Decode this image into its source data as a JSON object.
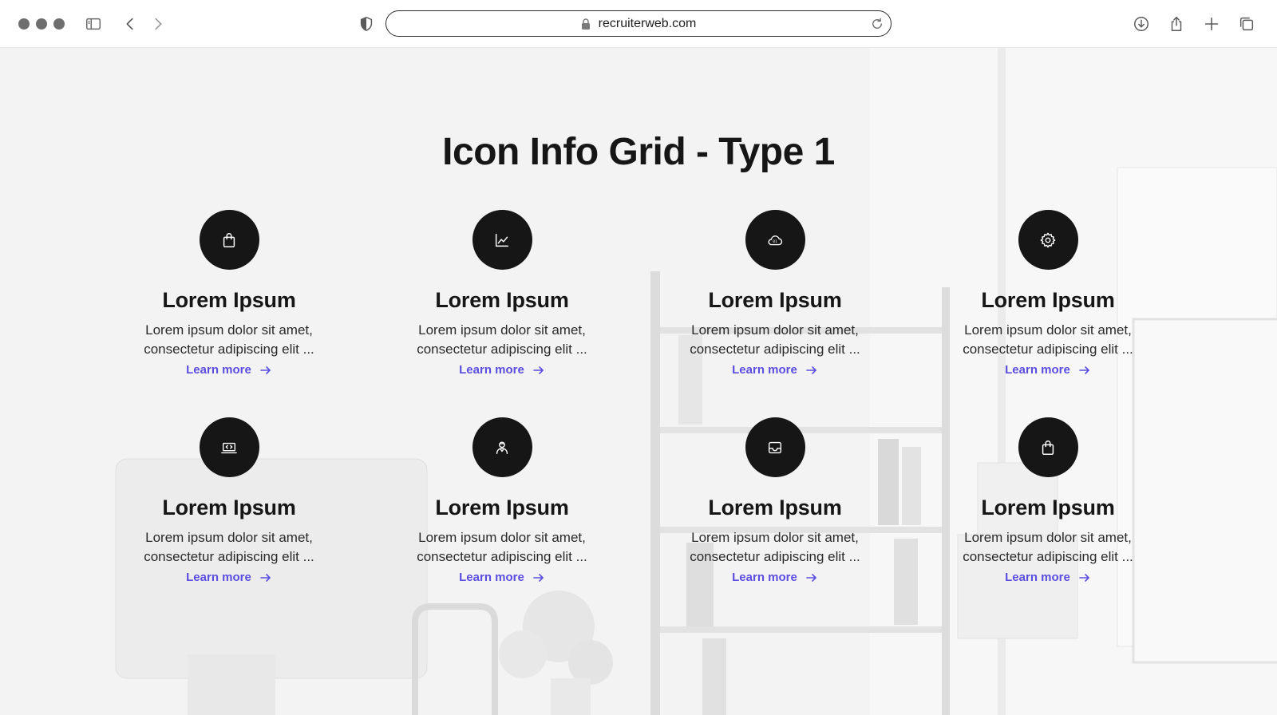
{
  "browser": {
    "url": "recruiterweb.com",
    "icons": [
      "sidebar-icon",
      "back-icon",
      "forward-icon",
      "shield-icon",
      "lock-icon",
      "reload-icon",
      "download-icon",
      "share-icon",
      "new-tab-icon",
      "tabs-overview-icon"
    ]
  },
  "page": {
    "heading": "Icon Info Grid - Type 1",
    "accent_color": "#5b4de0",
    "icon_circle_color": "#161616"
  },
  "cards": [
    {
      "icon": "shopping-bag-icon",
      "title": "Lorem Ipsum",
      "line1": "Lorem ipsum dolor sit amet,",
      "line2": "consectetur adipiscing elit ...",
      "link": "Learn more"
    },
    {
      "icon": "line-chart-icon",
      "title": "Lorem Ipsum",
      "line1": "Lorem ipsum dolor sit amet,",
      "line2": "consectetur adipiscing elit ...",
      "link": "Learn more"
    },
    {
      "icon": "cloud-data-icon",
      "title": "Lorem Ipsum",
      "line1": "Lorem ipsum dolor sit amet,",
      "line2": "consectetur adipiscing elit ...",
      "link": "Learn more"
    },
    {
      "icon": "gear-icon",
      "title": "Lorem Ipsum",
      "line1": "Lorem ipsum dolor sit amet,",
      "line2": "consectetur adipiscing elit ...",
      "link": "Learn more"
    },
    {
      "icon": "laptop-code-icon",
      "title": "Lorem Ipsum",
      "line1": "Lorem ipsum dolor sit amet,",
      "line2": "consectetur adipiscing elit ...",
      "link": "Learn more"
    },
    {
      "icon": "user-badge-icon",
      "title": "Lorem Ipsum",
      "line1": "Lorem ipsum dolor sit amet,",
      "line2": "consectetur adipiscing elit ...",
      "link": "Learn more"
    },
    {
      "icon": "inbox-icon",
      "title": "Lorem Ipsum",
      "line1": "Lorem ipsum dolor sit amet,",
      "line2": "consectetur adipiscing elit ...",
      "link": "Learn more"
    },
    {
      "icon": "shopping-bag-icon",
      "title": "Lorem Ipsum",
      "line1": "Lorem ipsum dolor sit amet,",
      "line2": "consectetur adipiscing elit ...",
      "link": "Learn more"
    }
  ]
}
